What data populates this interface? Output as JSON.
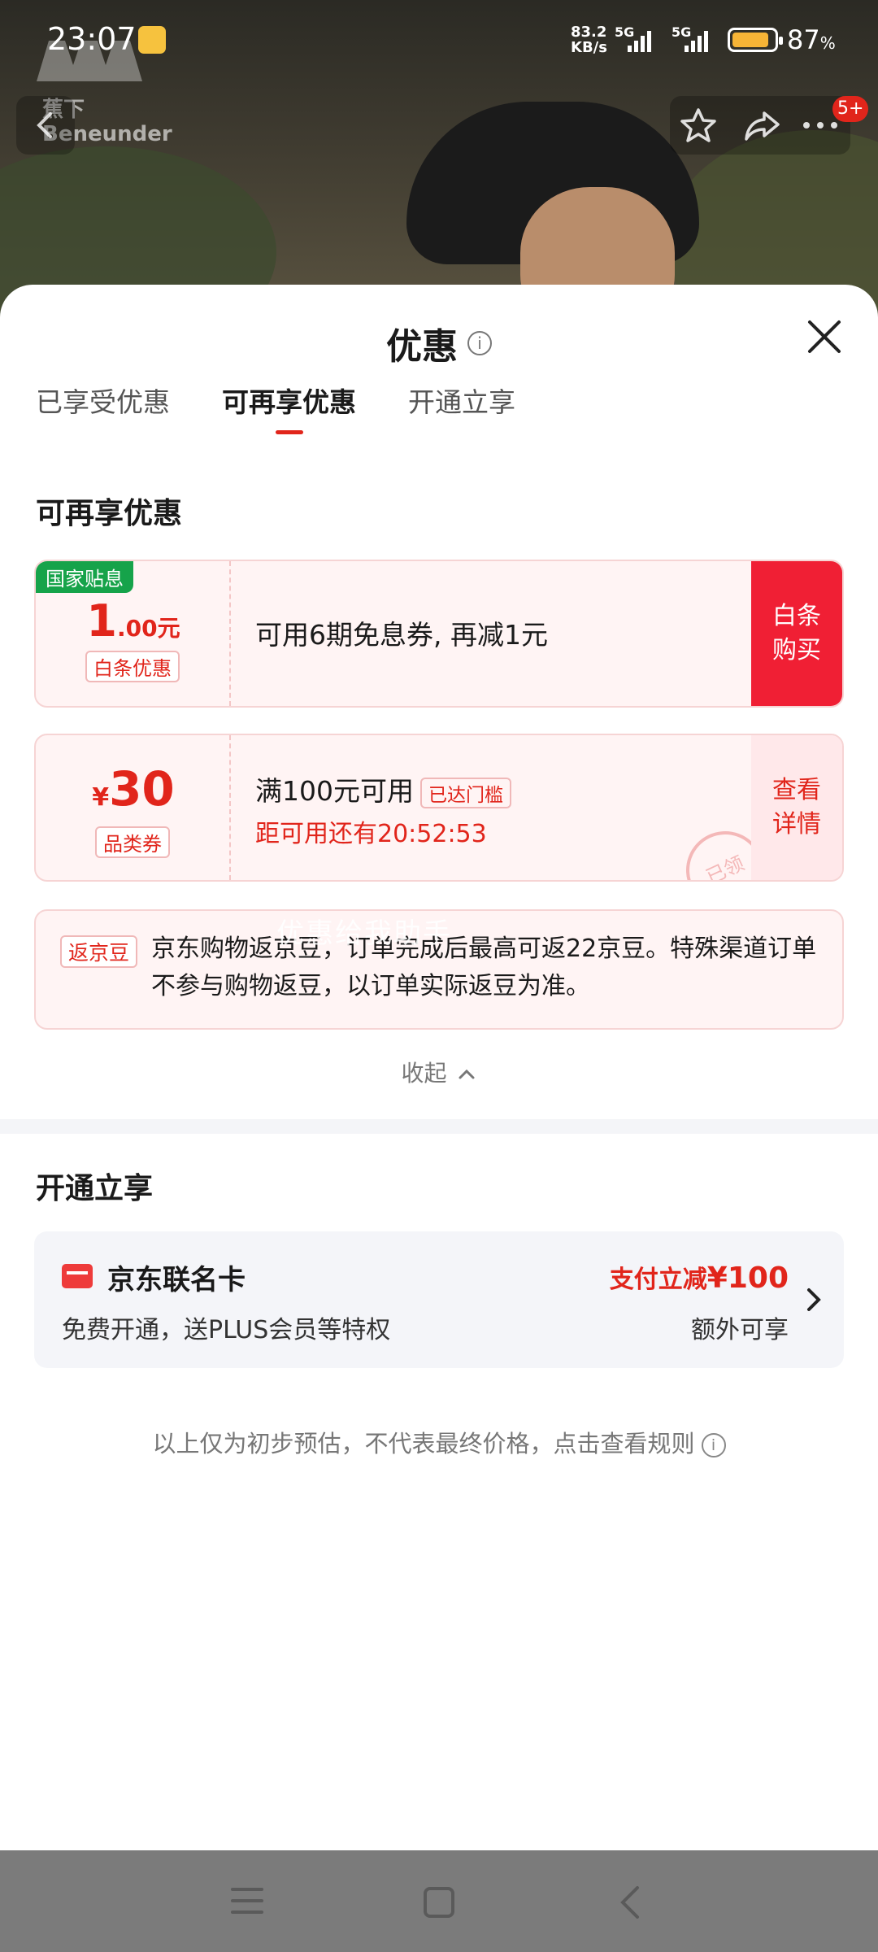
{
  "status_bar": {
    "time": "23:07",
    "net_speed_value": "83.2",
    "net_speed_unit": "KB/s",
    "signal1_label": "5G",
    "signal2_label": "5G",
    "battery_pct": "87",
    "battery_unit": "%"
  },
  "product_header": {
    "brand_line1": "蕉下",
    "brand_line2": "Beneunder",
    "cart_badge": "5+"
  },
  "sheet": {
    "title": "优惠",
    "tabs": [
      {
        "label": "已享受优惠",
        "active": false
      },
      {
        "label": "可再享优惠",
        "active": true
      },
      {
        "label": "开通立享",
        "active": false
      }
    ],
    "section1_title": "可再享优惠",
    "coupons": [
      {
        "corner_tag": "国家贴息",
        "amount_int": "1",
        "amount_dec": ".00元",
        "type_tag": "白条优惠",
        "desc": "可用6期免息券, 再减1元",
        "action": "白条购买"
      },
      {
        "currency": "¥",
        "amount_int": "30",
        "type_tag": "品类券",
        "desc": "满100元可用",
        "reached_tag": "已达门槛",
        "countdown": "距可用还有20:52:53",
        "action": "查看详情",
        "stamp": "已领"
      }
    ],
    "cashback": {
      "tag": "返京豆",
      "text": "京东购物返京豆，订单完成后最高可返22京豆。特殊渠道订单不参与购物返豆，以订单实际返豆为准。",
      "watermark": "优惠给我助手"
    },
    "collapse_label": "收起",
    "section2_title": "开通立享",
    "card": {
      "name": "京东联名卡",
      "sub": "免费开通，送PLUS会员等特权",
      "promo_prefix": "支付立减",
      "promo_amount": "¥100",
      "extra": "额外可享"
    },
    "disclaimer": "以上仅为初步预估，不代表最终价格，点击查看规则"
  },
  "colors": {
    "accent_red": "#e1251b",
    "subsidy_green": "#16a34a"
  }
}
